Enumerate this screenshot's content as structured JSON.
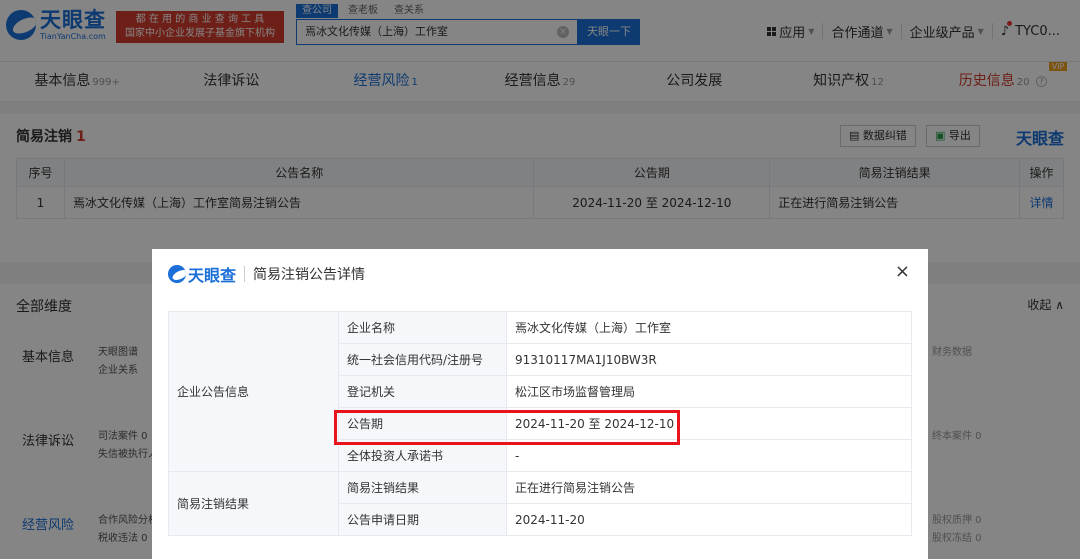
{
  "header": {
    "logo_cn": "天眼查",
    "logo_en": "TianYanCha.com",
    "slogan_line1": "都 在 用 的 商 业 查 询 工 具",
    "slogan_line2": "国家中小企业发展子基金旗下机构",
    "search_tabs": [
      "查公司",
      "查老板",
      "查关系"
    ],
    "search_value": "焉冰文化传媒（上海）工作室",
    "search_button": "天眼一下",
    "nav": {
      "apps": "应用",
      "channel": "合作通道",
      "enterprise": "企业级产品",
      "user": "TYC0..."
    }
  },
  "tabs": [
    {
      "label": "基本信息",
      "count": "999+"
    },
    {
      "label": "法律诉讼",
      "count": ""
    },
    {
      "label": "经营风险",
      "count": "1"
    },
    {
      "label": "经营信息",
      "count": "29"
    },
    {
      "label": "公司发展",
      "count": ""
    },
    {
      "label": "知识产权",
      "count": "12"
    },
    {
      "label": "历史信息",
      "count": "20"
    }
  ],
  "vip_badge": "VIP",
  "section": {
    "title": "简易注销",
    "count": "1",
    "btn_correct": "数据纠错",
    "btn_export": "导出",
    "brand": "天眼查",
    "columns": [
      "序号",
      "公告名称",
      "公告期",
      "简易注销结果",
      "操作"
    ],
    "rows": [
      {
        "no": "1",
        "name": "焉冰文化传媒（上海）工作室简易注销公告",
        "period": "2024-11-20 至 2024-12-10",
        "result": "正在进行简易注销公告",
        "action": "详情"
      }
    ]
  },
  "dims": {
    "title": "全部维度",
    "collapse": "收起",
    "rows": [
      {
        "label": "基本信息",
        "sub1": "天眼图谱",
        "sub2": "企业关系",
        "right": "财务数据"
      },
      {
        "label": "法律诉讼",
        "sub1": "司法案件 0",
        "sub2": "失信被执行人 0",
        "right": "终本案件 0"
      },
      {
        "label": "经营风险",
        "sub1": "合作风险分析 0",
        "sub2": "税收违法 0",
        "right": "股权质押 0",
        "right2": "股权冻结 0"
      }
    ]
  },
  "modal": {
    "brand": "天眼查",
    "title": "简易注销公告详情",
    "close": "×",
    "group1": "企业公告信息",
    "group2": "简易注销结果",
    "fields": [
      {
        "label": "企业名称",
        "value": "焉冰文化传媒（上海）工作室"
      },
      {
        "label": "统一社会信用代码/注册号",
        "value": "91310117MA1J10BW3R"
      },
      {
        "label": "登记机关",
        "value": "松江区市场监督管理局"
      },
      {
        "label": "公告期",
        "value": "2024-11-20 至 2024-12-10"
      },
      {
        "label": "全体投资人承诺书",
        "value": "-"
      },
      {
        "label": "简易注销结果",
        "value": "正在进行简易注销公告"
      },
      {
        "label": "公告申请日期",
        "value": "2024-11-20"
      }
    ]
  },
  "colors": {
    "brand_blue": "#1a6fd8",
    "alert_red": "#d33c2c",
    "highlight_red": "#e8131c"
  }
}
